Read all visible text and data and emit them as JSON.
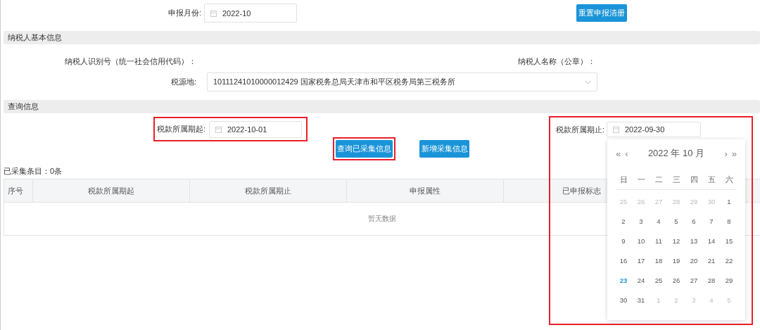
{
  "report_month": {
    "label": "申报月份:",
    "value": "2022-10"
  },
  "reset_button": "重置申报清册",
  "sections": [
    {
      "title": "纳税人基本信息"
    },
    {
      "title": "查询信息"
    }
  ],
  "taxpayer": {
    "id_label": "纳税人识别号（统一社会信用代码）：",
    "name_label": "纳税人名称（公章）：",
    "source_label": "税源地:",
    "source_value": "10111241010000012429 国家税务总局天津市和平区税务局第三税务所"
  },
  "query": {
    "start": {
      "label": "税款所属期起:",
      "value": "2022-10-01",
      "highlighted": true
    },
    "end": {
      "label": "税款所属期止:",
      "value": "2022-09-30",
      "highlighted": true
    },
    "buttons": [
      {
        "label": "查询已采集信息",
        "highlighted": true
      },
      {
        "label": "新增采集信息",
        "highlighted": false
      }
    ]
  },
  "count_text": "已采集条目：0条",
  "table": {
    "columns": [
      "序号",
      "税款所属期起",
      "税款所属期止",
      "申报属性",
      "已申报标志"
    ],
    "empty_text": "暂无数据"
  },
  "calendar": {
    "prev_year": "«",
    "prev_month": "‹",
    "title": "2022 年  10 月",
    "next_month": "›",
    "next_year": "»",
    "weekdays": [
      "日",
      "一",
      "二",
      "三",
      "四",
      "五",
      "六"
    ],
    "weeks": [
      [
        {
          "d": "25",
          "muted": true,
          "today": false
        },
        {
          "d": "26",
          "muted": true,
          "today": false
        },
        {
          "d": "27",
          "muted": true,
          "today": false
        },
        {
          "d": "28",
          "muted": true,
          "today": false
        },
        {
          "d": "29",
          "muted": true,
          "today": false
        },
        {
          "d": "30",
          "muted": true,
          "today": false
        },
        {
          "d": "1",
          "muted": false,
          "today": false
        }
      ],
      [
        {
          "d": "2",
          "muted": false,
          "today": false
        },
        {
          "d": "3",
          "muted": false,
          "today": false
        },
        {
          "d": "4",
          "muted": false,
          "today": false
        },
        {
          "d": "5",
          "muted": false,
          "today": false
        },
        {
          "d": "6",
          "muted": false,
          "today": false
        },
        {
          "d": "7",
          "muted": false,
          "today": false
        },
        {
          "d": "8",
          "muted": false,
          "today": false
        }
      ],
      [
        {
          "d": "9",
          "muted": false,
          "today": false
        },
        {
          "d": "10",
          "muted": false,
          "today": false
        },
        {
          "d": "11",
          "muted": false,
          "today": false
        },
        {
          "d": "12",
          "muted": false,
          "today": false
        },
        {
          "d": "13",
          "muted": false,
          "today": false
        },
        {
          "d": "14",
          "muted": false,
          "today": false
        },
        {
          "d": "15",
          "muted": false,
          "today": false
        }
      ],
      [
        {
          "d": "16",
          "muted": false,
          "today": false
        },
        {
          "d": "17",
          "muted": false,
          "today": false
        },
        {
          "d": "18",
          "muted": false,
          "today": false
        },
        {
          "d": "19",
          "muted": false,
          "today": false
        },
        {
          "d": "20",
          "muted": false,
          "today": false
        },
        {
          "d": "21",
          "muted": false,
          "today": false
        },
        {
          "d": "22",
          "muted": false,
          "today": false
        }
      ],
      [
        {
          "d": "23",
          "muted": false,
          "today": true
        },
        {
          "d": "24",
          "muted": false,
          "today": false
        },
        {
          "d": "25",
          "muted": false,
          "today": false
        },
        {
          "d": "26",
          "muted": false,
          "today": false
        },
        {
          "d": "27",
          "muted": false,
          "today": false
        },
        {
          "d": "28",
          "muted": false,
          "today": false
        },
        {
          "d": "29",
          "muted": false,
          "today": false
        }
      ],
      [
        {
          "d": "30",
          "muted": false,
          "today": false
        },
        {
          "d": "31",
          "muted": false,
          "today": false
        },
        {
          "d": "1",
          "muted": true,
          "today": false
        },
        {
          "d": "2",
          "muted": true,
          "today": false
        },
        {
          "d": "3",
          "muted": true,
          "today": false
        },
        {
          "d": "4",
          "muted": true,
          "today": false
        },
        {
          "d": "5",
          "muted": true,
          "today": false
        }
      ]
    ]
  }
}
